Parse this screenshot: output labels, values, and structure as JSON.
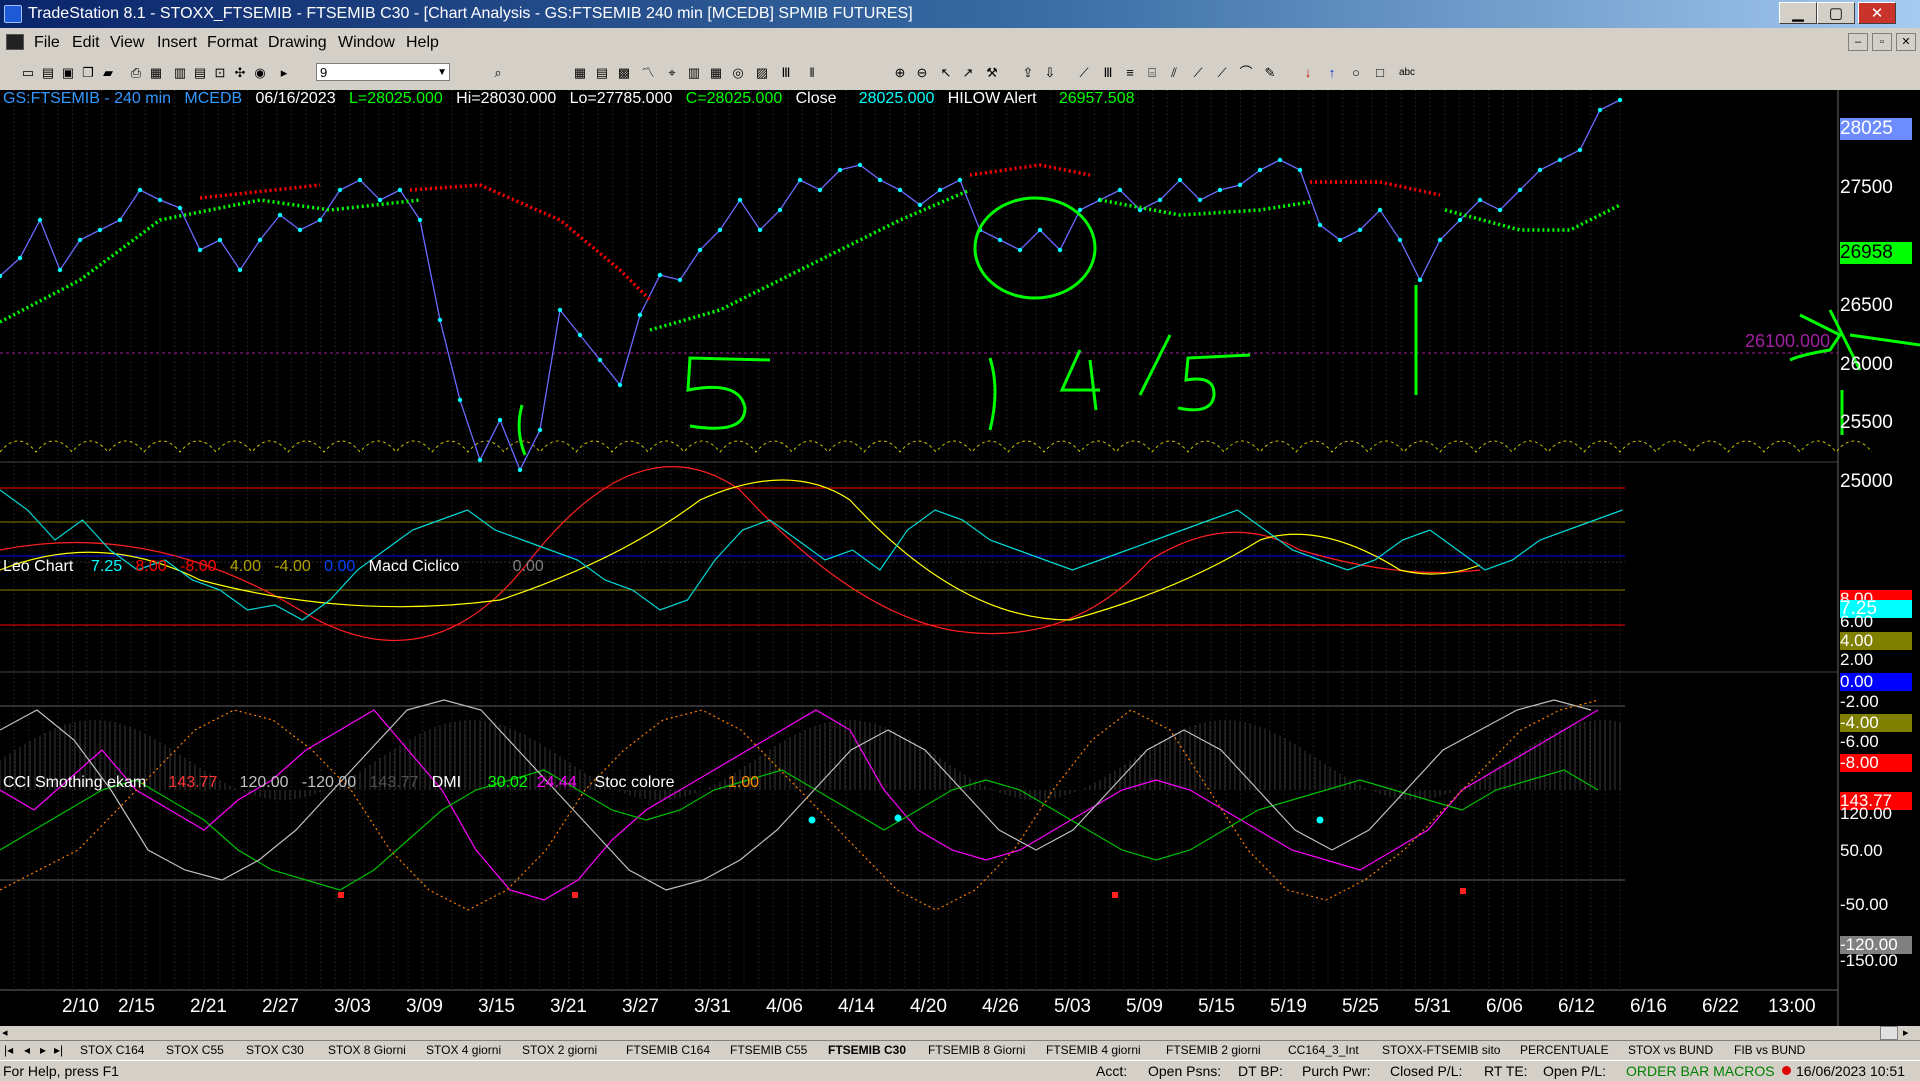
{
  "window": {
    "title": "TradeStation 8.1 - STOXX_FTSEMIB - FTSEMIB C30 - [Chart Analysis - GS:FTSEMIB  240 min  [MCEDB] SPMIB FUTURES]",
    "min_glyph": "▁",
    "max_glyph": "▢",
    "close_glyph": "✕"
  },
  "menu": {
    "items": [
      "File",
      "Edit",
      "View",
      "Insert",
      "Format",
      "Drawing",
      "Window",
      "Help"
    ],
    "mdi": [
      "–",
      "▫",
      "✕"
    ]
  },
  "toolbar": {
    "combo_value": "9",
    "icons": [
      "new-icon",
      "open-icon",
      "save-icon",
      "copy-icon",
      "folder-icon",
      "print-icon",
      "print-preview-icon",
      "page-icon",
      "page2-icon",
      "lock-icon",
      "tools-icon",
      "globe-icon",
      "play-icon",
      "find-icon",
      "grid-icon",
      "grid2-icon",
      "table-icon",
      "line-chart-icon",
      "scan-icon",
      "layout-icon",
      "matrix-icon",
      "radar-icon",
      "chart2-icon",
      "bars-icon",
      "candle-icon",
      "zoom-in-icon",
      "zoom-out-icon",
      "cursor-icon",
      "pointer-icon",
      "hammer-icon",
      "export-icon",
      "import-icon",
      "trendline-icon",
      "vertical-lines-icon",
      "horizontal-lines-icon",
      "fibonacci-icon",
      "channel-icon",
      "speed-lines-icon",
      "gann-icon",
      "arc-icon",
      "pen-icon",
      "arrow-down-icon",
      "arrow-up-icon",
      "circle-icon",
      "rectangle-icon",
      "text-icon"
    ]
  },
  "chart": {
    "header": {
      "symbol": "GS:FTSEMIB - 240 min",
      "feed": "MCEDB",
      "date": "06/16/2023",
      "last": "L=28025.000",
      "high": "Hi=28030.000",
      "low": "Lo=27785.000",
      "close_label": "C=28025.000",
      "close_word": "Close",
      "close_value": "28025.000",
      "alert_name": "HILOW Alert",
      "alert_value": "26957.508"
    },
    "price_axis": {
      "labels": [
        "28025",
        "27500",
        "26958",
        "26500",
        "26000",
        "25500",
        "25000"
      ],
      "hline_label": "26100.000"
    },
    "leo_panel": {
      "title": "Leo Chart",
      "values": [
        "7.25",
        "8.00",
        "-8.00",
        "4.00",
        "-4.00",
        "0.00"
      ],
      "macd_title": "Macd Ciclico",
      "macd_value": "0.00",
      "axis_labels": [
        "8.00",
        "7.25",
        "6.00",
        "4.00",
        "2.00",
        "0.00",
        "-2.00",
        "-4.00",
        "-6.00",
        "-8.00"
      ]
    },
    "cci_panel": {
      "title": "CCI Smothing ekam",
      "values": [
        "143.77",
        "120.00",
        "-120.00",
        "143.77"
      ],
      "dmi_title": "DMI",
      "dmi_values": [
        "30.02",
        "24.44"
      ],
      "stoc_title": "Stoc colore",
      "stoc_value": "1.00",
      "axis_labels": [
        "143.77",
        "120.00",
        "50.00",
        "-50.00",
        "-120.00",
        "-150.00"
      ]
    },
    "x_axis": [
      "2/10",
      "2/15",
      "2/21",
      "2/27",
      "3/03",
      "3/09",
      "3/15",
      "3/21",
      "3/27",
      "3/31",
      "4/06",
      "4/14",
      "4/20",
      "4/26",
      "5/03",
      "5/09",
      "5/15",
      "5/19",
      "5/25",
      "5/31",
      "6/06",
      "6/12",
      "6/16",
      "6/22",
      "13:00"
    ],
    "colors": {
      "price": "#00ffff",
      "stops_up": "#00ff00",
      "stops_down": "#ff0000",
      "annotation": "#00ff00",
      "axis_highlight_cyan": "#00ffff",
      "axis_highlight_green": "#00ff00"
    }
  },
  "tabs": [
    "STOX C164",
    "STOX C55",
    "STOX  C30",
    "STOX  8 Giorni",
    "STOX 4 giorni",
    "STOX  2 giorni",
    "FTSEMIB C164",
    "FTSEMIB C55",
    "FTSEMIB C30",
    "FTSEMIB  8 Giorni",
    "FTSEMIB  4 giorni",
    "FTSEMIB  2 giorni",
    "CC164_3_Int",
    "STOXX-FTSEMIB sito",
    "PERCENTUALE",
    "STOX vs BUND",
    "FIB vs BUND"
  ],
  "tab_nav": [
    "|◂",
    "◂",
    "▸",
    "▸|"
  ],
  "active_tab": "FTSEMIB C30",
  "status": {
    "help": "For Help, press F1",
    "acct": "Acct:",
    "open_psns": "Open Psns:",
    "dt_bp": "DT BP:",
    "purch_pwr": "Purch Pwr:",
    "closed_pl": "Closed P/L:",
    "rt_te": "RT TE:",
    "open_pl": "Open P/L:",
    "macros": "ORDER BAR  MACROS",
    "datetime": "16/06/2023 10:51"
  }
}
